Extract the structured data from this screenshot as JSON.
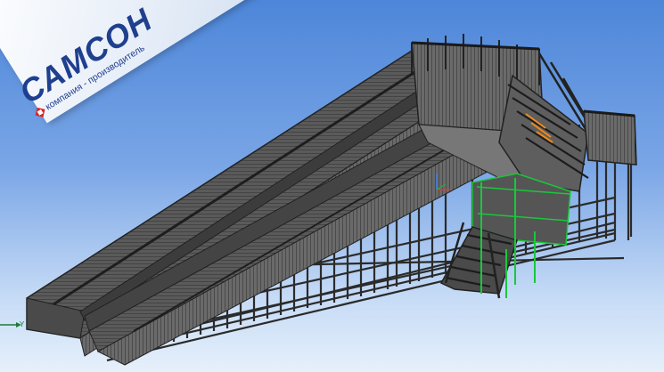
{
  "brand": {
    "name": "САМСОН",
    "tagline": "компания - производитель"
  },
  "viewport": {
    "axis_y_label": "Y"
  },
  "colors": {
    "background_top": "#4d86d9",
    "background_bottom": "#e6f0fb",
    "model_dark": "#3a3a3a",
    "selected_green": "#19c83a",
    "highlight_orange": "#f08a1c",
    "brand_blue": "#1f3f8f",
    "brand_red": "#dd2222"
  }
}
